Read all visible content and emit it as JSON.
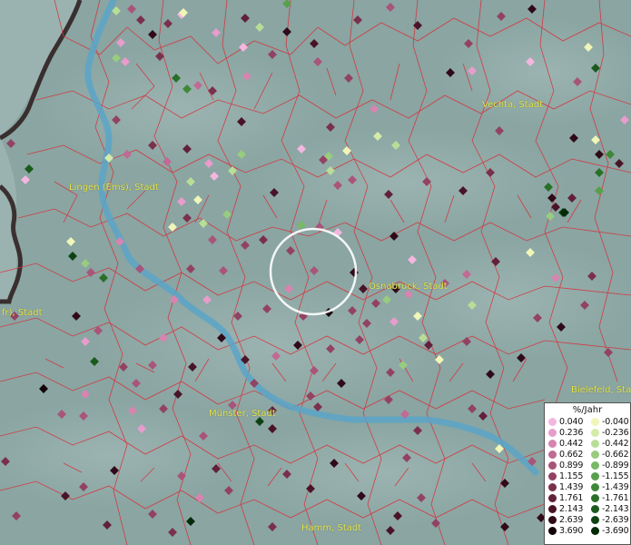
{
  "map": {
    "cities": [
      {
        "id": "vechta",
        "label": "Vechta, Stadt"
      },
      {
        "id": "lingen",
        "label": "Lingen (Ems), Stadt"
      },
      {
        "id": "osnabrueck",
        "label": "Osnabrück, Stadt"
      },
      {
        "id": "muenster",
        "label": "Münster, Stadt"
      },
      {
        "id": "bielefeld",
        "label": "Bielefeld, Stadt"
      },
      {
        "id": "hamm",
        "label": "Hamm, Stadt"
      },
      {
        "id": "partial-left",
        "label": "fr), Stadt"
      }
    ],
    "colors": {
      "background": "#8fa9a6",
      "borders": "#d8303a",
      "river": "#5aa4c8",
      "country_border": "#2a1a1a",
      "highlight_circle": "#ffffff"
    }
  },
  "legend": {
    "title": "%/Jahr",
    "positive": [
      {
        "label": "0.040",
        "color": "#f4b6e0"
      },
      {
        "label": "0.236",
        "color": "#e89ccc"
      },
      {
        "label": "0.442",
        "color": "#d884b0"
      },
      {
        "label": "0.662",
        "color": "#c06a94"
      },
      {
        "label": "0.899",
        "color": "#a95479"
      },
      {
        "label": "1.155",
        "color": "#924262"
      },
      {
        "label": "1.439",
        "color": "#7a304c"
      },
      {
        "label": "1.761",
        "color": "#62203a"
      },
      {
        "label": "2.143",
        "color": "#4a1428"
      },
      {
        "label": "2.639",
        "color": "#300a18"
      },
      {
        "label": "3.690",
        "color": "#140208"
      }
    ],
    "negative": [
      {
        "label": "-0.040",
        "color": "#f0f6b8"
      },
      {
        "label": "-0.236",
        "color": "#d4ecaa"
      },
      {
        "label": "-0.442",
        "color": "#b8de96"
      },
      {
        "label": "-0.662",
        "color": "#98cc7e"
      },
      {
        "label": "-0.899",
        "color": "#78b866"
      },
      {
        "label": "-1.155",
        "color": "#58a04c"
      },
      {
        "label": "-1.439",
        "color": "#3e8838"
      },
      {
        "label": "-1.761",
        "color": "#2a7028"
      },
      {
        "label": "-2.143",
        "color": "#1a5a1c"
      },
      {
        "label": "-2.639",
        "color": "#0e4212"
      },
      {
        "label": "-3.690",
        "color": "#042a08"
      }
    ]
  }
}
